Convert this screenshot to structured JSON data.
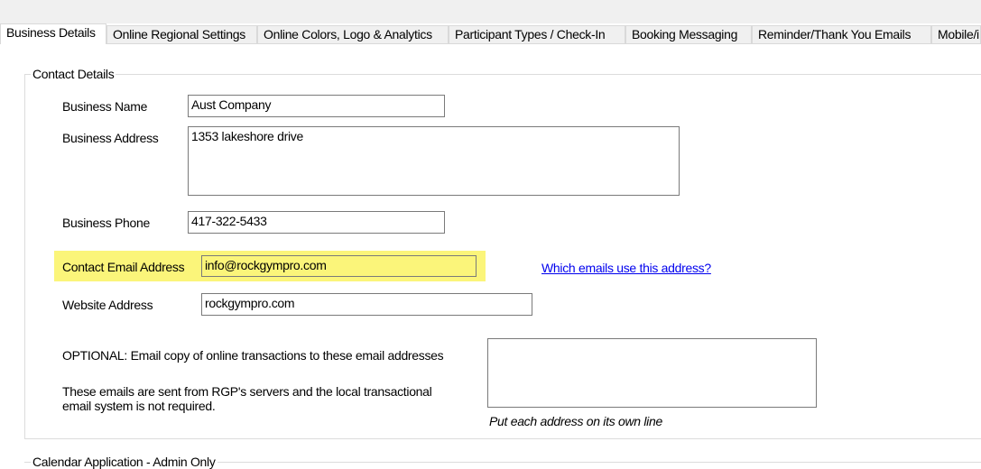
{
  "tabs": [
    {
      "label": "Business Details",
      "active": true
    },
    {
      "label": "Online Regional Settings",
      "active": false
    },
    {
      "label": "Online Colors, Logo & Analytics",
      "active": false
    },
    {
      "label": "Participant Types / Check-In",
      "active": false
    },
    {
      "label": "Booking Messaging",
      "active": false
    },
    {
      "label": "Reminder/Thank You Emails",
      "active": false
    },
    {
      "label": "Mobile/i",
      "active": false
    }
  ],
  "contact_details": {
    "legend": "Contact Details",
    "business_name": {
      "label": "Business Name",
      "value": "Aust Company"
    },
    "business_address": {
      "label": "Business Address",
      "value": "1353 lakeshore drive"
    },
    "business_phone": {
      "label": "Business Phone",
      "value": "417-322-5433"
    },
    "contact_email": {
      "label": "Contact Email Address",
      "value": "info@rockgympro.com"
    },
    "email_link": "Which emails use this address?",
    "website": {
      "label": "Website Address",
      "value": "rockgympro.com"
    },
    "optional_label": "OPTIONAL: Email copy of online transactions to these email addresses",
    "servers_note": "These emails are sent from RGP's servers and the local transactional email system is not required.",
    "copy_emails_value": "",
    "copy_emails_hint": "Put each address on its own line"
  },
  "calendar": {
    "legend": "Calendar Application - Admin Only"
  },
  "colors": {
    "highlight": "#fbf57a",
    "link": "#0000ee"
  }
}
